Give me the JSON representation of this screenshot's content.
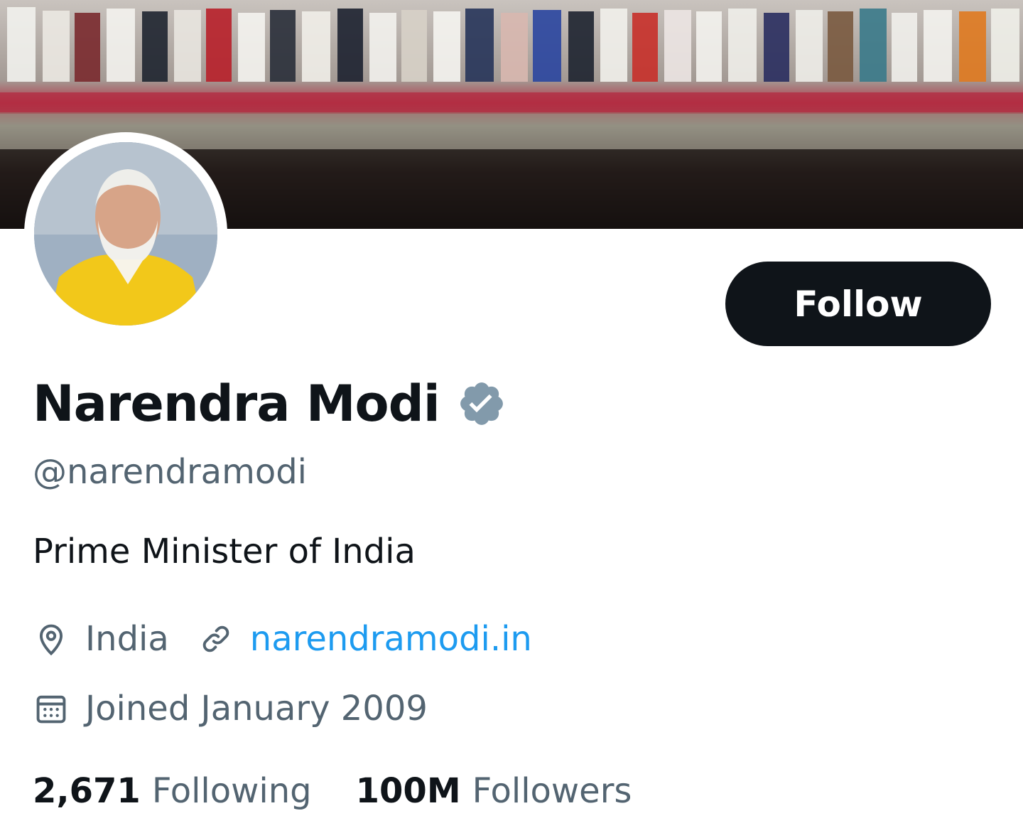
{
  "profile": {
    "display_name": "Narendra Modi",
    "handle": "@narendramodi",
    "bio": "Prime Minister of India",
    "location": "India",
    "website": "narendramodi.in",
    "joined": "Joined January 2009",
    "verified_badge_color": "#829aab"
  },
  "actions": {
    "follow_label": "Follow"
  },
  "stats": {
    "following_count": "2,671",
    "following_label": "Following",
    "followers_count": "100M",
    "followers_label": "Followers"
  },
  "colors": {
    "primary_text": "#0f1419",
    "secondary_text": "#536471",
    "link": "#1d9bf0",
    "button_bg": "#0f1419"
  },
  "icons": {
    "location": "location-pin-icon",
    "website": "link-icon",
    "joined": "calendar-icon",
    "verified": "verified-badge-icon"
  }
}
